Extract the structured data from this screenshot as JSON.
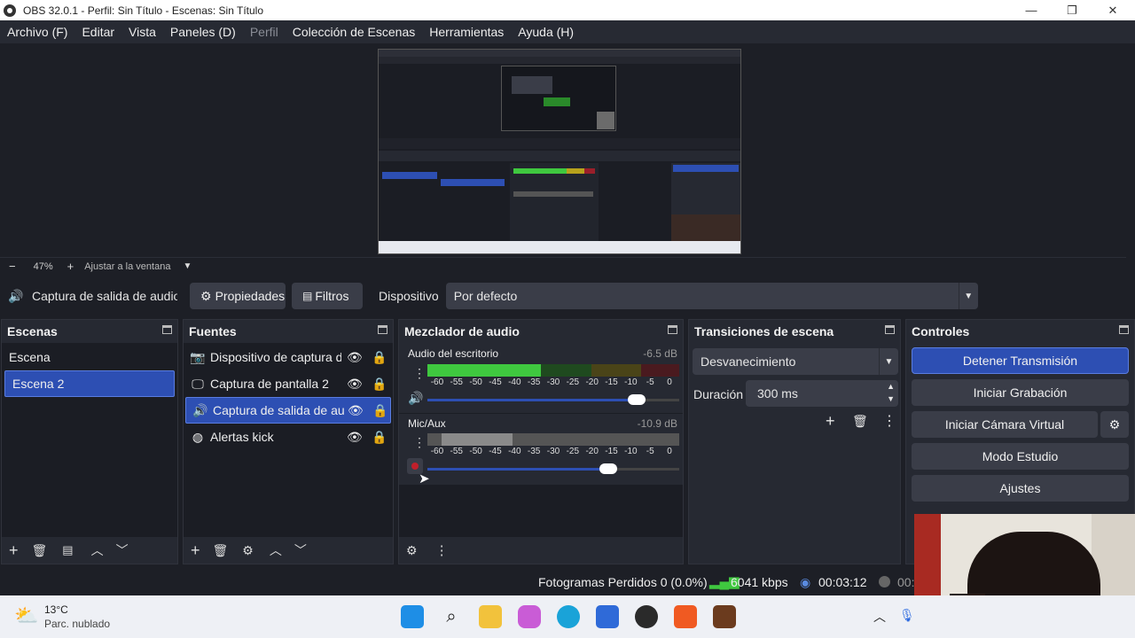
{
  "window": {
    "title": "OBS 32.0.1 - Perfil: Sin Título - Escenas: Sin Título"
  },
  "menu": [
    "Archivo (F)",
    "Editar",
    "Vista",
    "Paneles (D)",
    "Perfil",
    "Colección de Escenas",
    "Herramientas",
    "Ayuda (H)"
  ],
  "zoom": {
    "minus": "−",
    "value": "47%",
    "plus": "+",
    "fit_label": "Ajustar a la ventana"
  },
  "source_toolbar": {
    "source_name": "Captura de salida de audio",
    "properties": "Propiedades",
    "filters": "Filtros",
    "device_label": "Dispositivo",
    "device_value": "Por defecto"
  },
  "scenes": {
    "title": "Escenas",
    "items": [
      "Escena",
      "Escena 2"
    ],
    "selected": 1
  },
  "sources": {
    "title": "Fuentes",
    "items": [
      {
        "name": "Dispositivo de captura de vídeo",
        "icon": "camera-icon"
      },
      {
        "name": "Captura de pantalla 2",
        "icon": "monitor-icon"
      },
      {
        "name": "Captura de salida de audio",
        "icon": "speaker-icon"
      },
      {
        "name": "Alertas kick",
        "icon": "globe-icon"
      }
    ],
    "selected": 2
  },
  "mixer": {
    "title": "Mezclador de audio",
    "channels": [
      {
        "name": "Audio del escritorio",
        "db": "-6.5 dB",
        "level": 0.45,
        "volume": 0.83,
        "muted": false
      },
      {
        "name": "Mic/Aux",
        "db": "-10.9 dB",
        "level": 0.0,
        "volume": 0.72,
        "muted": true
      }
    ],
    "ticks": [
      "-60",
      "-55",
      "-50",
      "-45",
      "-40",
      "-35",
      "-30",
      "-25",
      "-20",
      "-15",
      "-10",
      "-5",
      "0"
    ]
  },
  "transitions": {
    "title": "Transiciones de escena",
    "selected": "Desvanecimiento",
    "duration_label": "Duración",
    "duration_value": "300 ms"
  },
  "controls": {
    "title": "Controles",
    "stream": "Detener Transmisión",
    "record": "Iniciar Grabación",
    "virtual_cam": "Iniciar Cámara Virtual",
    "studio": "Modo Estudio",
    "settings": "Ajustes"
  },
  "status": {
    "dropped": "Fotogramas Perdidos 0 (0.0%)",
    "bitrate": "6041 kbps",
    "stream_time": "00:03:12",
    "rec_time": "00:"
  },
  "taskbar": {
    "temp": "13°C",
    "weather": "Parc. nublado"
  },
  "colors": {
    "accent": "#2d4fb3",
    "meter_green": "#3fc83f",
    "meter_yellow": "#b8a21c",
    "meter_red": "#9a1f2a"
  }
}
